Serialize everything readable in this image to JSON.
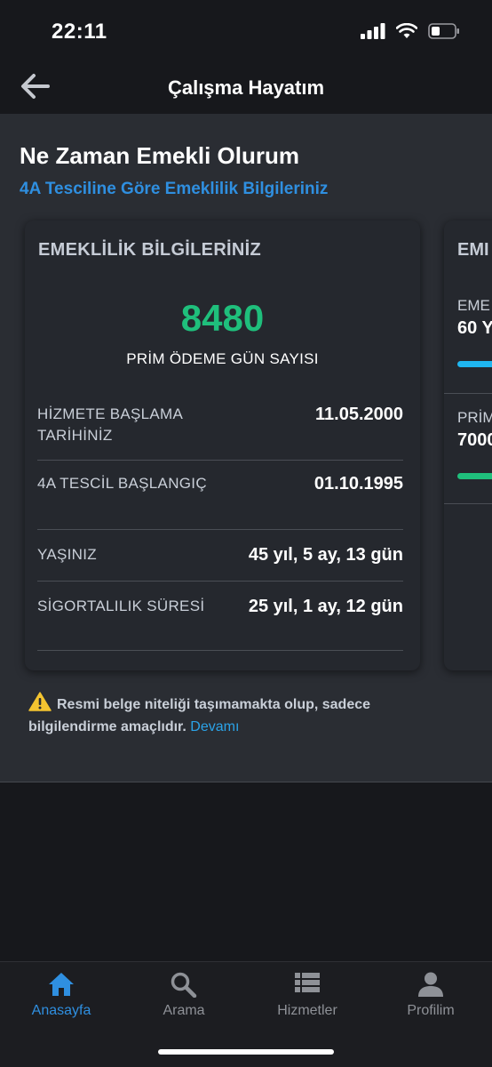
{
  "status_bar": {
    "time": "22:11"
  },
  "nav": {
    "title": "Çalışma Hayatım"
  },
  "page": {
    "title": "Ne Zaman Emekli Olurum",
    "subtitle": "4A Tesciline Göre Emeklilik Bilgileriniz"
  },
  "card": {
    "title": "EMEKLİLİK BİLGİLERİNİZ",
    "prim_days": "8480",
    "prim_days_label": "PRİM ÖDEME GÜN SAYISI",
    "rows": [
      {
        "label": "HİZMETE BAŞLAMA TARİHİNİZ",
        "value": "11.05.2000"
      },
      {
        "label": "4A TESCİL BAŞLANGIÇ",
        "value": "01.10.1995"
      },
      {
        "label": "YAŞINIZ",
        "value": "45 yıl, 5 ay, 13 gün"
      },
      {
        "label": "SİGORTALILIK SÜRESİ",
        "value": "25 yıl, 1 ay, 12 gün"
      }
    ]
  },
  "peek_card": {
    "title": "EMI",
    "row1_label": "EME",
    "row1_value": "60 Y",
    "row2_label": "PRİM",
    "row2_value": "7000",
    "bar1_color": "#1fb6f0",
    "bar2_color": "#1fbf7c"
  },
  "disclaimer": {
    "text": "Resmi belge niteliği taşımamakta olup, sadece bilgilendirme amaçlıdır.",
    "link": "Devamı"
  },
  "tabs": [
    {
      "label": "Anasayfa",
      "icon": "home-icon",
      "active": true
    },
    {
      "label": "Arama",
      "icon": "search-icon",
      "active": false
    },
    {
      "label": "Hizmetler",
      "icon": "list-icon",
      "active": false
    },
    {
      "label": "Profilim",
      "icon": "person-icon",
      "active": false
    }
  ],
  "colors": {
    "accent": "#2f8fe0",
    "success": "#1fbf7c",
    "link": "#2ba3e8",
    "warning": "#f4c430"
  }
}
